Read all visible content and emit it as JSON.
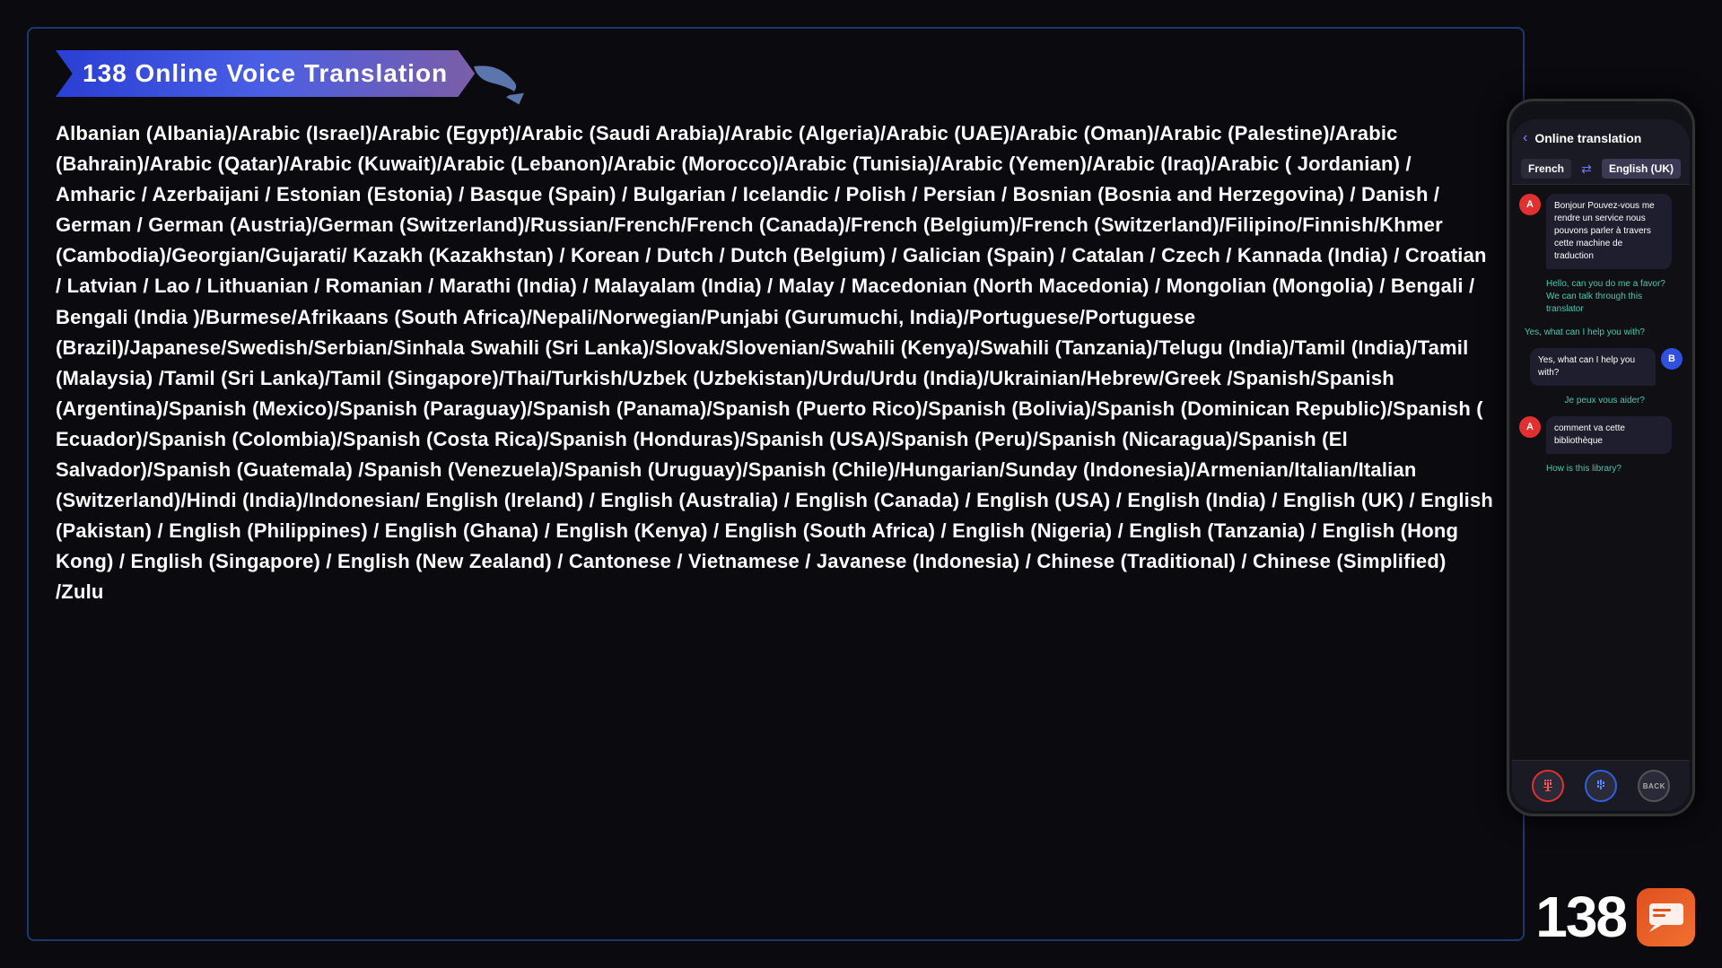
{
  "title": {
    "badge_text": "138 Online Voice Translation",
    "number": "138"
  },
  "languages_text": "Albanian (Albania)/Arabic (Israel)/Arabic (Egypt)/Arabic (Saudi Arabia)/Arabic (Algeria)/Arabic (UAE)/Arabic (Oman)/Arabic (Palestine)/Arabic (Bahrain)/Arabic (Qatar)/Arabic (Kuwait)/Arabic (Lebanon)/Arabic (Morocco)/Arabic (Tunisia)/Arabic (Yemen)/Arabic (Iraq)/Arabic ( Jordanian) / Amharic / Azerbaijani / Estonian (Estonia) / Basque (Spain) / Bulgarian / Icelandic / Polish / Persian / Bosnian (Bosnia and Herzegovina) / Danish / German / German (Austria)/German (Switzerland)/Russian/French/French (Canada)/French (Belgium)/French (Switzerland)/Filipino/Finnish/Khmer (Cambodia)/Georgian/Gujarati/ Kazakh (Kazakhstan) / Korean / Dutch / Dutch (Belgium) / Galician (Spain) / Catalan / Czech / Kannada (India) / Croatian / Latvian / Lao / Lithuanian / Romanian / Marathi (India) / Malayalam (India) / Malay / Macedonian (North Macedonia) / Mongolian (Mongolia) / Bengali / Bengali (India )/Burmese/Afrikaans (South Africa)/Nepali/Norwegian/Punjabi (Gurumuchi, India)/Portuguese/Portuguese (Brazil)/Japanese/Swedish/Serbian/Sinhala Swahili (Sri Lanka)/Slovak/Slovenian/Swahili (Kenya)/Swahili (Tanzania)/Telugu (India)/Tamil (India)/Tamil (Malaysia) /Tamil (Sri Lanka)/Tamil (Singapore)/Thai/Turkish/Uzbek (Uzbekistan)/Urdu/Urdu (India)/Ukrainian/Hebrew/Greek /Spanish/Spanish (Argentina)/Spanish (Mexico)/Spanish (Paraguay)/Spanish (Panama)/Spanish (Puerto Rico)/Spanish (Bolivia)/Spanish (Dominican Republic)/Spanish ( Ecuador)/Spanish (Colombia)/Spanish (Costa Rica)/Spanish (Honduras)/Spanish (USA)/Spanish (Peru)/Spanish (Nicaragua)/Spanish (El Salvador)/Spanish (Guatemala) /Spanish (Venezuela)/Spanish (Uruguay)/Spanish (Chile)/Hungarian/Sunday (Indonesia)/Armenian/Italian/Italian (Switzerland)/Hindi (India)/Indonesian/ English (Ireland) / English (Australia) / English (Canada) / English (USA) / English (India) / English (UK) / English (Pakistan) / English (Philippines) / English (Ghana) / English (Kenya) / English (South Africa) / English (Nigeria) / English (Tanzania) / English (Hong Kong) / English (Singapore) / English (New Zealand) / Cantonese / Vietnamese / Javanese (Indonesia) / Chinese (Traditional) / Chinese (Simplified) /Zulu",
  "phone": {
    "header_title": "Online translation",
    "back_label": "‹",
    "lang_from": "French",
    "lang_to": "English (UK)",
    "swap_icon": "⇄",
    "messages": [
      {
        "type": "left",
        "avatar": "A",
        "text": "Bonjour Pouvez-vous me rendre un service nous pouvons parler à travers cette machine de traduction"
      },
      {
        "type": "translation-left",
        "text": "Hello, can you do me a favor? We can talk through this translator"
      },
      {
        "type": "translation-right",
        "text": "Yes, what can I help you with?"
      },
      {
        "type": "right",
        "avatar": "B",
        "text": "Yes, what can I help you with?"
      },
      {
        "type": "translation-right-fr",
        "text": "Je peux vous aider?"
      },
      {
        "type": "left",
        "avatar": "A",
        "text": "comment va cette bibliothèque"
      },
      {
        "type": "translation-left-2",
        "text": "How is this library?"
      }
    ],
    "bottom_buttons": [
      "mic-left",
      "mic-right",
      "back"
    ]
  },
  "bottom_right": {
    "number": "138"
  },
  "colors": {
    "background": "#0a0a0f",
    "accent_blue": "#2a3fd4",
    "accent_teal": "#4ac8b0",
    "accent_orange": "#e05020",
    "avatar_a": "#e03030",
    "avatar_b": "#3050e0"
  }
}
